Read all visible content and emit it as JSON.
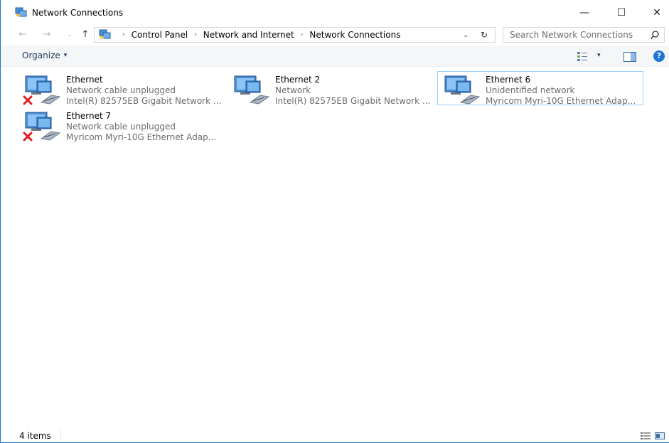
{
  "window": {
    "title": "Network Connections",
    "minimize_glyph": "—",
    "maximize_glyph": "☐",
    "close_glyph": "✕",
    "icon": "network-connections-icon"
  },
  "address": {
    "back_glyph": "←",
    "forward_glyph": "→",
    "recent_glyph": "⌄",
    "up_glyph": "↑",
    "breadcrumbs": [
      "Control Panel",
      "Network and Internet",
      "Network Connections"
    ],
    "separator": "›",
    "dropdown_glyph": "⌄",
    "refresh_glyph": "↻"
  },
  "search": {
    "placeholder": "Search Network Connections"
  },
  "commandbar": {
    "organize_label": "Organize",
    "organize_arrow": "▾",
    "view_arrow": "▾",
    "help_glyph": "?"
  },
  "connections": [
    {
      "name": "Ethernet",
      "status": "Network cable unplugged",
      "device": "Intel(R) 82575EB Gigabit Network ...",
      "unplugged": true,
      "selected": false
    },
    {
      "name": "Ethernet 2",
      "status": "Network",
      "device": "Intel(R) 82575EB Gigabit Network ...",
      "unplugged": false,
      "selected": false
    },
    {
      "name": "Ethernet 6",
      "status": "Unidentified network",
      "device": "Myricom Myri-10G Ethernet Adap...",
      "unplugged": false,
      "selected": true
    },
    {
      "name": "Ethernet 7",
      "status": "Network cable unplugged",
      "device": "Myricom Myri-10G Ethernet Adap...",
      "unplugged": true,
      "selected": false
    }
  ],
  "statusbar": {
    "item_count": "4 items"
  },
  "colors": {
    "accent": "#1979ca",
    "selection_border": "#99d1ff",
    "secondary_text": "#6d6d6d",
    "error_x": "#e02020"
  }
}
